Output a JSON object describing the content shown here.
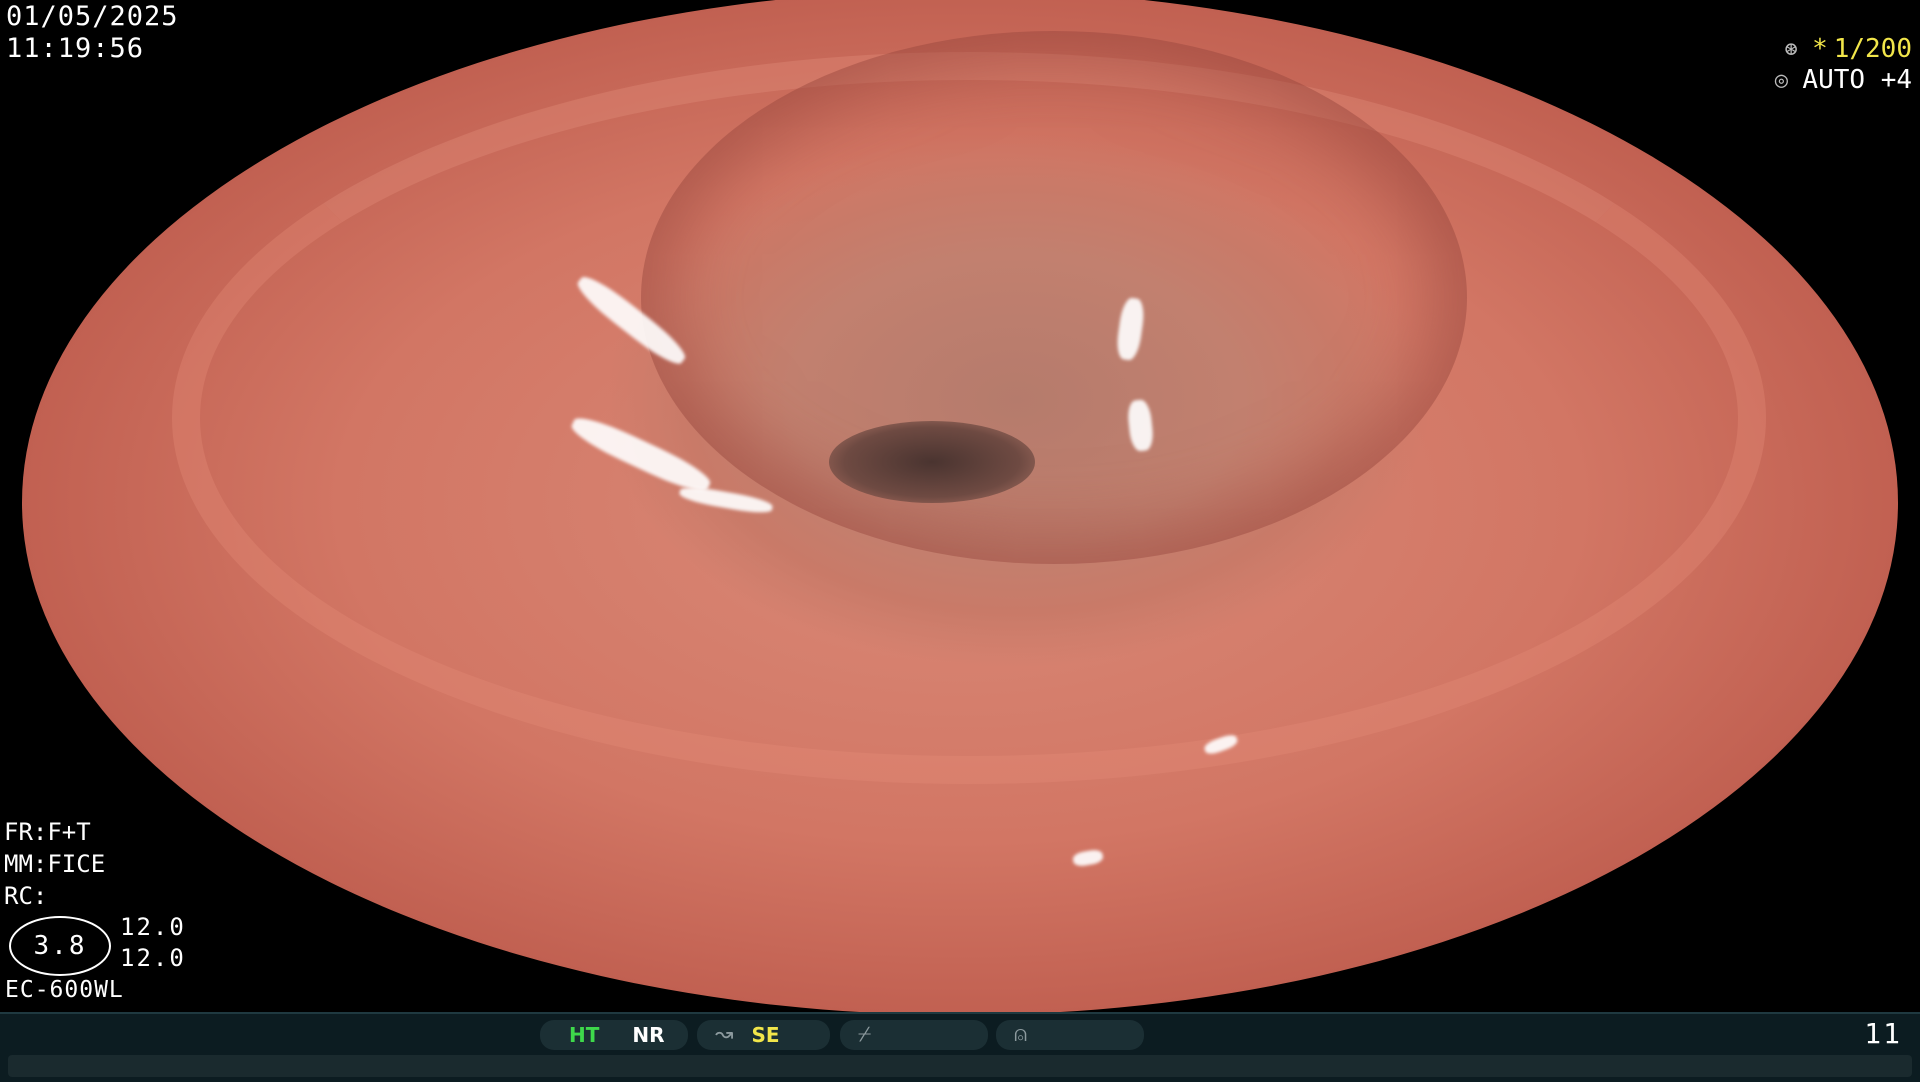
{
  "overlay": {
    "date": "01/05/2025",
    "time": "11:19:56"
  },
  "status_top_right": {
    "shutter_icon": "aperture-icon",
    "shutter": "1/200",
    "shutter_marker": "*",
    "iris_icon": "iris-icon",
    "iris": "AUTO +4"
  },
  "left_info": {
    "fr": "FR:F+T",
    "mm": "MM:FICE",
    "rc": "RC:",
    "zoom_oval": "3.8",
    "value_a": "12.0",
    "value_b": "12.0",
    "model": "EC-600WL"
  },
  "bottom_bar": {
    "ht": "HT",
    "nr": "NR",
    "se": "SE",
    "page": "11",
    "icons": [
      "wave-icon",
      "curve-icon",
      "slash-icon",
      "circle-symbol-icon"
    ]
  },
  "colors": {
    "ht": "#3ed94b",
    "se": "#f2e64a",
    "shutter": "#f2e64a",
    "bar": "#0c1c21"
  }
}
